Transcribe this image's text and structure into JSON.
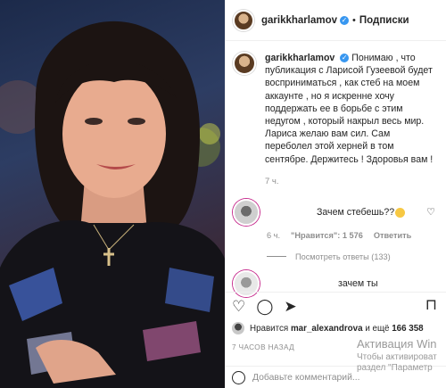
{
  "header": {
    "username": "garikkharlamov",
    "follow_label": "Подписки",
    "separator": "•"
  },
  "caption": {
    "username": "garikkharlamov",
    "text": "Понимаю , что публикация с Ларисой Гузеевой будет восприниматься , как стеб на моем аккаунте , но я искренне хочу поддержать ее в борьбе с этим недугом , который накрыл весь мир. Лариса желаю вам сил. Сам переболел этой херней в том сентябре. Держитесь ! Здоровья вам !",
    "time": "7 ч."
  },
  "comment1": {
    "text": "Зачем стебешь??",
    "time": "6 ч.",
    "likes": "\"Нравится\": 1 576",
    "reply_label": "Ответить",
    "view_replies": "Посмотреть ответы (133)"
  },
  "comment2": {
    "text": "зачем ты"
  },
  "likes": {
    "prefix": "Нравится",
    "user": "mar_alexandrova",
    "and_more": "и ещё",
    "count": "166 358"
  },
  "post_date": "7 ЧАСОВ НАЗАД",
  "add_comment": {
    "placeholder": "Добавьте комментарий..."
  },
  "windows_activation": {
    "title": "Активация Win",
    "line1": "Чтобы активироват",
    "line2": "раздел \"Параметр"
  },
  "icons": [
    "verified-badge-icon",
    "heart-icon",
    "comment-icon",
    "share-icon",
    "bookmark-icon",
    "emoji-icon"
  ],
  "colors": {
    "verified": "#3897f0",
    "muted": "#8e8e8e",
    "text": "#262626"
  }
}
